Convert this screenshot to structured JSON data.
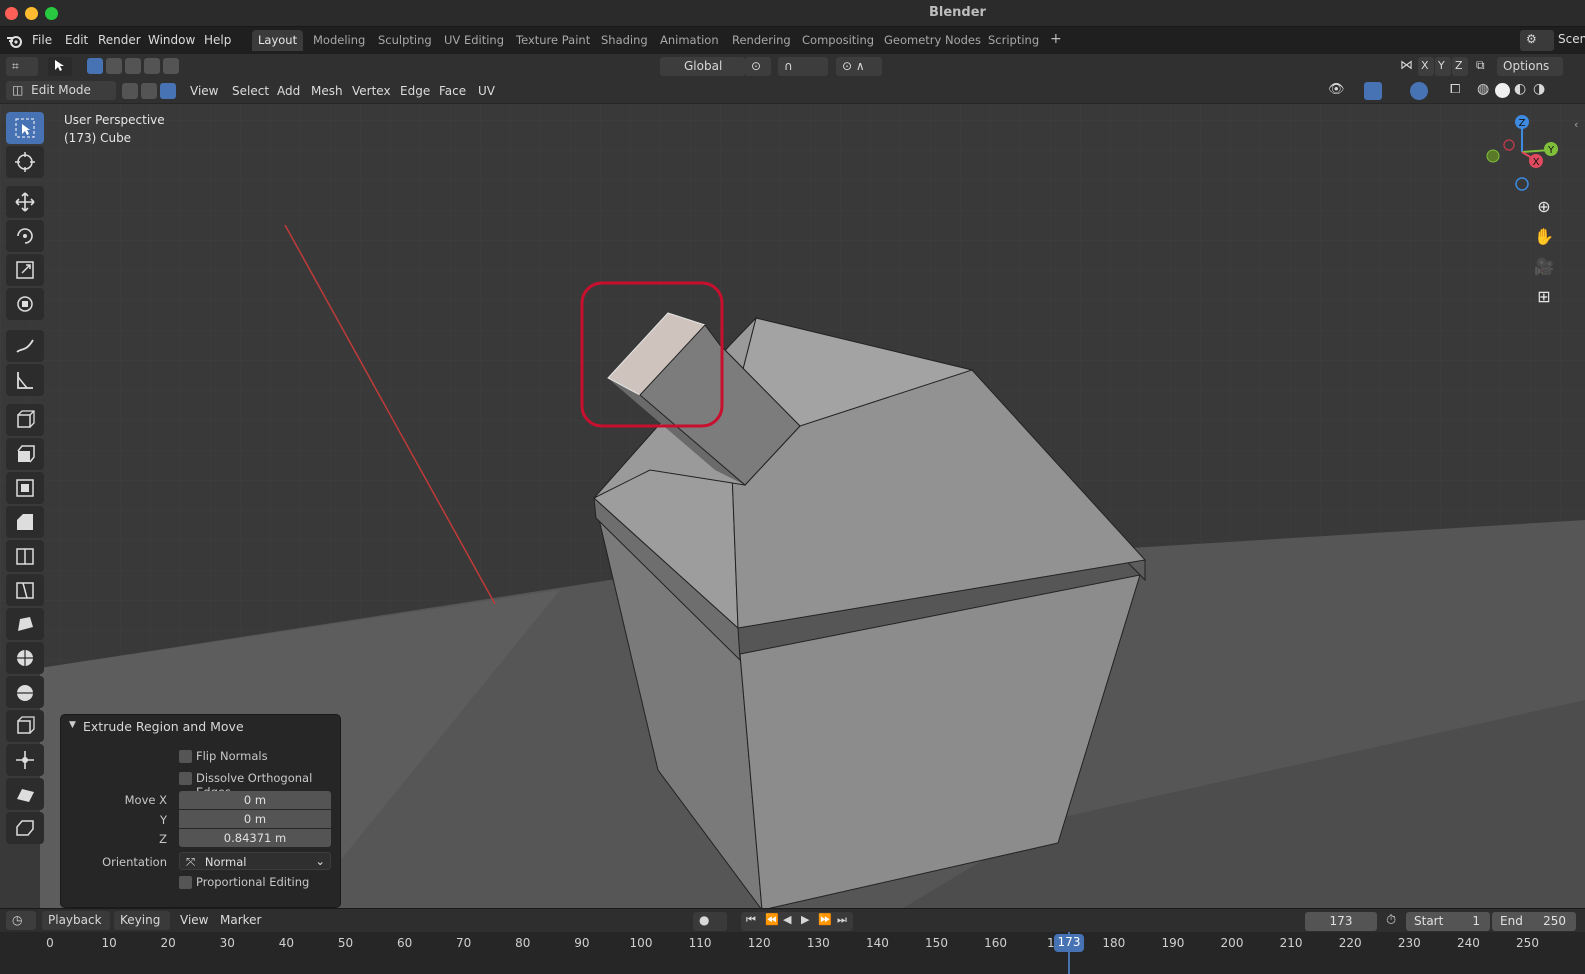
{
  "window": {
    "title": "Blender"
  },
  "menubar": {
    "items": [
      "File",
      "Edit",
      "Render",
      "Window",
      "Help"
    ],
    "workspaces": [
      "Layout",
      "Modeling",
      "Sculpting",
      "UV Editing",
      "Texture Paint",
      "Shading",
      "Animation",
      "Rendering",
      "Compositing",
      "Geometry Nodes",
      "Scripting"
    ],
    "active_workspace": "Layout",
    "add_tab": "+",
    "scene_label": "Scen"
  },
  "toolheader": {
    "orientation": "Global",
    "axes": [
      "X",
      "Y",
      "Z"
    ],
    "options_label": "Options"
  },
  "modeheader": {
    "mode": "Edit Mode",
    "menus": [
      "View",
      "Select",
      "Add",
      "Mesh",
      "Vertex",
      "Edge",
      "Face",
      "UV"
    ]
  },
  "viewport": {
    "perspective_label": "User Perspective",
    "object_label": "(173) Cube",
    "gizmo_axes": {
      "x": "X",
      "y": "Y",
      "z": "Z"
    },
    "colors": {
      "x_axis": "#e04a5f",
      "y_axis": "#7fbf3a",
      "z_axis": "#3d8ae0",
      "highlight": "#c8102e"
    }
  },
  "operator_panel": {
    "title": "Extrude Region and Move",
    "flip_normals": "Flip Normals",
    "dissolve": "Dissolve Orthogonal Edges",
    "move_x_label": "Move X",
    "move_y_label": "Y",
    "move_z_label": "Z",
    "move_x": "0 m",
    "move_y": "0 m",
    "move_z": "0.84371 m",
    "orientation_label": "Orientation",
    "orientation_value": "Normal",
    "proportional": "Proportional Editing"
  },
  "timeline": {
    "menus": [
      "Playback",
      "Keying",
      "View",
      "Marker"
    ],
    "current_frame": "173",
    "start_label": "Start",
    "start_value": "1",
    "end_label": "End",
    "end_value": "250",
    "ticks": [
      "0",
      "10",
      "20",
      "30",
      "40",
      "50",
      "60",
      "70",
      "80",
      "90",
      "100",
      "110",
      "120",
      "130",
      "140",
      "150",
      "160",
      "17",
      "180",
      "190",
      "200",
      "210",
      "220",
      "230",
      "240",
      "250"
    ],
    "playhead_label": "173"
  }
}
